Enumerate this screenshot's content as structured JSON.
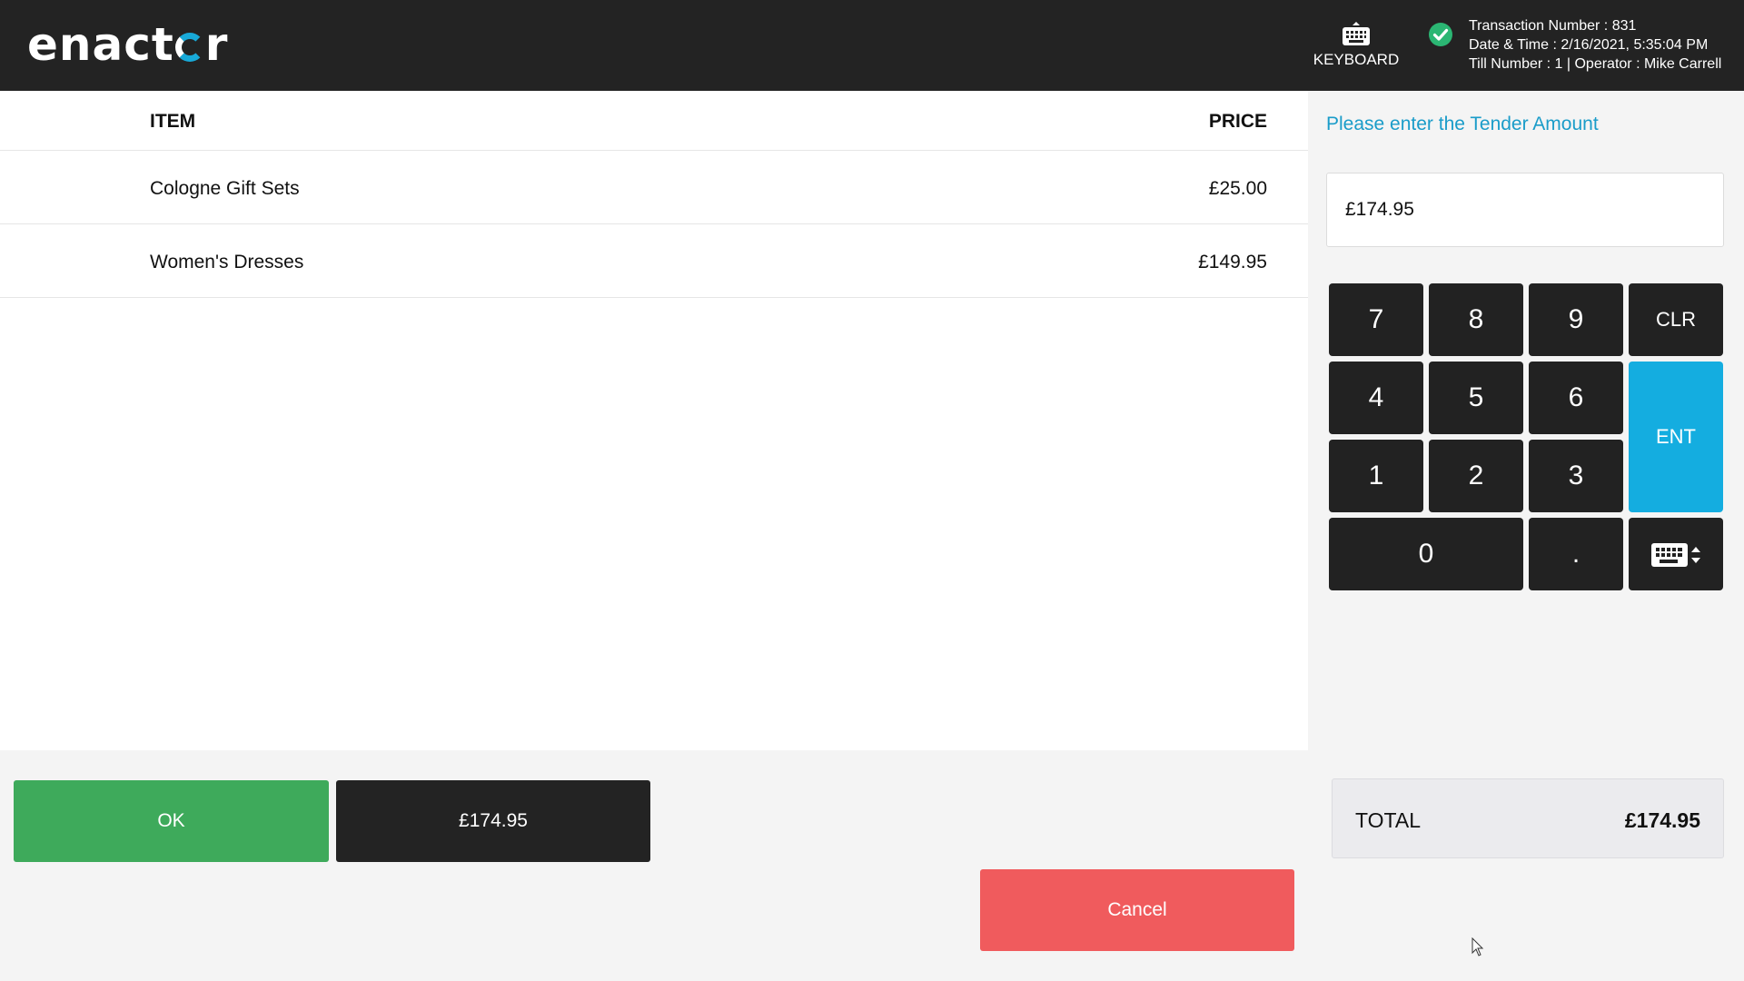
{
  "header": {
    "logo_before": "enact",
    "logo_after": "r",
    "keyboard_label": "KEYBOARD",
    "transaction_number": "Transaction Number : 831",
    "date_time": "Date & Time : 2/16/2021, 5:35:04 PM",
    "till_operator": "Till Number : 1 | Operator : Mike Carrell",
    "status_icon": "check-circle-icon",
    "status_color": "#2bb673"
  },
  "items": {
    "column_item": "ITEM",
    "column_price": "PRICE",
    "rows": [
      {
        "name": "Cologne Gift Sets",
        "price": "£25.00"
      },
      {
        "name": "Women's Dresses",
        "price": "£149.95"
      }
    ]
  },
  "tender": {
    "prompt": "Please enter the Tender Amount",
    "input_value": "£174.95"
  },
  "keypad": {
    "k7": "7",
    "k8": "8",
    "k9": "9",
    "clr": "CLR",
    "k4": "4",
    "k5": "5",
    "k6": "6",
    "ent": "ENT",
    "k1": "1",
    "k2": "2",
    "k3": "3",
    "k0": "0",
    "dot": ".",
    "keyboard_toggle_icon": "keyboard-toggle-icon"
  },
  "totals": {
    "label": "TOTAL",
    "value": "£174.95"
  },
  "actions": {
    "ok_label": "OK",
    "amount_label": "£174.95",
    "cancel_label": "Cancel"
  },
  "colors": {
    "header_bg": "#232323",
    "accent": "#14ade0",
    "ok": "#3eaa5b",
    "cancel": "#f05b5d"
  }
}
